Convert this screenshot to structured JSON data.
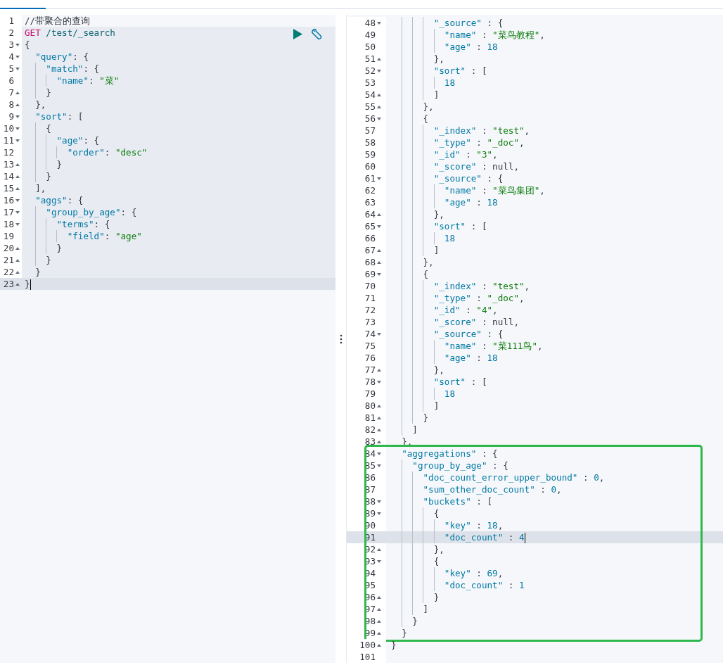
{
  "request_panel": {
    "groups": [
      {
        "kind": "plain",
        "lines": [
          {
            "number": "1",
            "active": false,
            "kind": "plain",
            "tokens": [
              {
                "kind": "comment",
                "text": "//带聚合的查询"
              }
            ]
          }
        ]
      },
      {
        "kind": "request",
        "lines": [
          {
            "number": "2",
            "active": false,
            "kind": "plain",
            "tokens": [
              {
                "kind": "method",
                "text": "GET"
              },
              {
                "kind": "url",
                "text": " /test/_search"
              }
            ]
          },
          {
            "number": "3",
            "active": false,
            "kind": "opener",
            "tokens": [
              {
                "kind": "punct",
                "text": "{"
              }
            ]
          },
          {
            "number": "4",
            "active": false,
            "kind": "opener",
            "tokens": [
              {
                "kind": "key",
                "text": "  \"query\""
              },
              {
                "kind": "punct",
                "text": ": {"
              }
            ]
          },
          {
            "number": "5",
            "active": false,
            "kind": "opener",
            "tokens": [
              {
                "kind": "key",
                "text": "    \"match\""
              },
              {
                "kind": "punct",
                "text": ": {"
              }
            ]
          },
          {
            "number": "6",
            "active": false,
            "kind": "plain",
            "tokens": [
              {
                "kind": "key",
                "text": "      \"name\""
              },
              {
                "kind": "punct",
                "text": ": "
              },
              {
                "kind": "string",
                "text": "\"菜\""
              }
            ]
          },
          {
            "number": "7",
            "active": false,
            "kind": "closer",
            "tokens": [
              {
                "kind": "punct",
                "text": "    }"
              }
            ]
          },
          {
            "number": "8",
            "active": false,
            "kind": "closer",
            "tokens": [
              {
                "kind": "punct",
                "text": "  },"
              }
            ]
          },
          {
            "number": "9",
            "active": false,
            "kind": "opener",
            "tokens": [
              {
                "kind": "key",
                "text": "  \"sort\""
              },
              {
                "kind": "punct",
                "text": ": ["
              }
            ]
          },
          {
            "number": "10",
            "active": false,
            "kind": "opener",
            "tokens": [
              {
                "kind": "punct",
                "text": "    {"
              }
            ]
          },
          {
            "number": "11",
            "active": false,
            "kind": "opener",
            "tokens": [
              {
                "kind": "key",
                "text": "      \"age\""
              },
              {
                "kind": "punct",
                "text": ": {"
              }
            ]
          },
          {
            "number": "12",
            "active": false,
            "kind": "plain",
            "tokens": [
              {
                "kind": "key",
                "text": "        \"order\""
              },
              {
                "kind": "punct",
                "text": ": "
              },
              {
                "kind": "string",
                "text": "\"desc\""
              }
            ]
          },
          {
            "number": "13",
            "active": false,
            "kind": "closer",
            "tokens": [
              {
                "kind": "punct",
                "text": "      }"
              }
            ]
          },
          {
            "number": "14",
            "active": false,
            "kind": "closer",
            "tokens": [
              {
                "kind": "punct",
                "text": "    }"
              }
            ]
          },
          {
            "number": "15",
            "active": false,
            "kind": "closer",
            "tokens": [
              {
                "kind": "punct",
                "text": "  ],"
              }
            ]
          },
          {
            "number": "16",
            "active": false,
            "kind": "opener",
            "tokens": [
              {
                "kind": "key",
                "text": "  \"aggs\""
              },
              {
                "kind": "punct",
                "text": ": {"
              }
            ]
          },
          {
            "number": "17",
            "active": false,
            "kind": "opener",
            "tokens": [
              {
                "kind": "key",
                "text": "    \"group_by_age\""
              },
              {
                "kind": "punct",
                "text": ": {"
              }
            ]
          },
          {
            "number": "18",
            "active": false,
            "kind": "opener",
            "tokens": [
              {
                "kind": "key",
                "text": "      \"terms\""
              },
              {
                "kind": "punct",
                "text": ": {"
              }
            ]
          },
          {
            "number": "19",
            "active": false,
            "kind": "plain",
            "tokens": [
              {
                "kind": "key",
                "text": "        \"field\""
              },
              {
                "kind": "punct",
                "text": ": "
              },
              {
                "kind": "string",
                "text": "\"age\""
              }
            ]
          },
          {
            "number": "20",
            "active": false,
            "kind": "closer",
            "tokens": [
              {
                "kind": "punct",
                "text": "      }"
              }
            ]
          },
          {
            "number": "21",
            "active": false,
            "kind": "closer",
            "tokens": [
              {
                "kind": "punct",
                "text": "    }"
              }
            ]
          },
          {
            "number": "22",
            "active": false,
            "kind": "closer",
            "tokens": [
              {
                "kind": "punct",
                "text": "  }"
              }
            ]
          },
          {
            "number": "23",
            "active": true,
            "kind": "closer",
            "tokens": [
              {
                "kind": "punct",
                "text": "}"
              }
            ]
          }
        ]
      }
    ]
  },
  "response_panel": {
    "groups": [
      {
        "kind": "plain",
        "lines": [
          {
            "number": "48",
            "active": false,
            "kind": "opener",
            "tokens": [
              {
                "kind": "key",
                "text": "        \"_source\""
              },
              {
                "kind": "punct",
                "text": " : {"
              }
            ]
          },
          {
            "number": "49",
            "active": false,
            "kind": "plain",
            "tokens": [
              {
                "kind": "key",
                "text": "          \"name\""
              },
              {
                "kind": "punct",
                "text": " : "
              },
              {
                "kind": "string",
                "text": "\"菜鸟教程\""
              },
              {
                "kind": "punct",
                "text": ","
              }
            ]
          },
          {
            "number": "50",
            "active": false,
            "kind": "plain",
            "tokens": [
              {
                "kind": "key",
                "text": "          \"age\""
              },
              {
                "kind": "punct",
                "text": " : "
              },
              {
                "kind": "number",
                "text": "18"
              }
            ]
          },
          {
            "number": "51",
            "active": false,
            "kind": "closer",
            "tokens": [
              {
                "kind": "punct",
                "text": "        },"
              }
            ]
          },
          {
            "number": "52",
            "active": false,
            "kind": "opener",
            "tokens": [
              {
                "kind": "key",
                "text": "        \"sort\""
              },
              {
                "kind": "punct",
                "text": " : ["
              }
            ]
          },
          {
            "number": "53",
            "active": false,
            "kind": "plain",
            "tokens": [
              {
                "kind": "number",
                "text": "          18"
              }
            ]
          },
          {
            "number": "54",
            "active": false,
            "kind": "closer",
            "tokens": [
              {
                "kind": "punct",
                "text": "        ]"
              }
            ]
          },
          {
            "number": "55",
            "active": false,
            "kind": "closer",
            "tokens": [
              {
                "kind": "punct",
                "text": "      },"
              }
            ]
          },
          {
            "number": "56",
            "active": false,
            "kind": "opener",
            "tokens": [
              {
                "kind": "punct",
                "text": "      {"
              }
            ]
          },
          {
            "number": "57",
            "active": false,
            "kind": "plain",
            "tokens": [
              {
                "kind": "key",
                "text": "        \"_index\""
              },
              {
                "kind": "punct",
                "text": " : "
              },
              {
                "kind": "string",
                "text": "\"test\""
              },
              {
                "kind": "punct",
                "text": ","
              }
            ]
          },
          {
            "number": "58",
            "active": false,
            "kind": "plain",
            "tokens": [
              {
                "kind": "key",
                "text": "        \"_type\""
              },
              {
                "kind": "punct",
                "text": " : "
              },
              {
                "kind": "string",
                "text": "\"_doc\""
              },
              {
                "kind": "punct",
                "text": ","
              }
            ]
          },
          {
            "number": "59",
            "active": false,
            "kind": "plain",
            "tokens": [
              {
                "kind": "key",
                "text": "        \"_id\""
              },
              {
                "kind": "punct",
                "text": " : "
              },
              {
                "kind": "string",
                "text": "\"3\""
              },
              {
                "kind": "punct",
                "text": ","
              }
            ]
          },
          {
            "number": "60",
            "active": false,
            "kind": "plain",
            "tokens": [
              {
                "kind": "key",
                "text": "        \"_score\""
              },
              {
                "kind": "punct",
                "text": " : "
              },
              {
                "kind": "null",
                "text": "null"
              },
              {
                "kind": "punct",
                "text": ","
              }
            ]
          },
          {
            "number": "61",
            "active": false,
            "kind": "opener",
            "tokens": [
              {
                "kind": "key",
                "text": "        \"_source\""
              },
              {
                "kind": "punct",
                "text": " : {"
              }
            ]
          },
          {
            "number": "62",
            "active": false,
            "kind": "plain",
            "tokens": [
              {
                "kind": "key",
                "text": "          \"name\""
              },
              {
                "kind": "punct",
                "text": " : "
              },
              {
                "kind": "string",
                "text": "\"菜鸟集团\""
              },
              {
                "kind": "punct",
                "text": ","
              }
            ]
          },
          {
            "number": "63",
            "active": false,
            "kind": "plain",
            "tokens": [
              {
                "kind": "key",
                "text": "          \"age\""
              },
              {
                "kind": "punct",
                "text": " : "
              },
              {
                "kind": "number",
                "text": "18"
              }
            ]
          },
          {
            "number": "64",
            "active": false,
            "kind": "closer",
            "tokens": [
              {
                "kind": "punct",
                "text": "        },"
              }
            ]
          },
          {
            "number": "65",
            "active": false,
            "kind": "opener",
            "tokens": [
              {
                "kind": "key",
                "text": "        \"sort\""
              },
              {
                "kind": "punct",
                "text": " : ["
              }
            ]
          },
          {
            "number": "66",
            "active": false,
            "kind": "plain",
            "tokens": [
              {
                "kind": "number",
                "text": "          18"
              }
            ]
          },
          {
            "number": "67",
            "active": false,
            "kind": "closer",
            "tokens": [
              {
                "kind": "punct",
                "text": "        ]"
              }
            ]
          },
          {
            "number": "68",
            "active": false,
            "kind": "closer",
            "tokens": [
              {
                "kind": "punct",
                "text": "      },"
              }
            ]
          },
          {
            "number": "69",
            "active": false,
            "kind": "opener",
            "tokens": [
              {
                "kind": "punct",
                "text": "      {"
              }
            ]
          },
          {
            "number": "70",
            "active": false,
            "kind": "plain",
            "tokens": [
              {
                "kind": "key",
                "text": "        \"_index\""
              },
              {
                "kind": "punct",
                "text": " : "
              },
              {
                "kind": "string",
                "text": "\"test\""
              },
              {
                "kind": "punct",
                "text": ","
              }
            ]
          },
          {
            "number": "71",
            "active": false,
            "kind": "plain",
            "tokens": [
              {
                "kind": "key",
                "text": "        \"_type\""
              },
              {
                "kind": "punct",
                "text": " : "
              },
              {
                "kind": "string",
                "text": "\"_doc\""
              },
              {
                "kind": "punct",
                "text": ","
              }
            ]
          },
          {
            "number": "72",
            "active": false,
            "kind": "plain",
            "tokens": [
              {
                "kind": "key",
                "text": "        \"_id\""
              },
              {
                "kind": "punct",
                "text": " : "
              },
              {
                "kind": "string",
                "text": "\"4\""
              },
              {
                "kind": "punct",
                "text": ","
              }
            ]
          },
          {
            "number": "73",
            "active": false,
            "kind": "plain",
            "tokens": [
              {
                "kind": "key",
                "text": "        \"_score\""
              },
              {
                "kind": "punct",
                "text": " : "
              },
              {
                "kind": "null",
                "text": "null"
              },
              {
                "kind": "punct",
                "text": ","
              }
            ]
          },
          {
            "number": "74",
            "active": false,
            "kind": "opener",
            "tokens": [
              {
                "kind": "key",
                "text": "        \"_source\""
              },
              {
                "kind": "punct",
                "text": " : {"
              }
            ]
          },
          {
            "number": "75",
            "active": false,
            "kind": "plain",
            "tokens": [
              {
                "kind": "key",
                "text": "          \"name\""
              },
              {
                "kind": "punct",
                "text": " : "
              },
              {
                "kind": "string",
                "text": "\"菜111鸟\""
              },
              {
                "kind": "punct",
                "text": ","
              }
            ]
          },
          {
            "number": "76",
            "active": false,
            "kind": "plain",
            "tokens": [
              {
                "kind": "key",
                "text": "          \"age\""
              },
              {
                "kind": "punct",
                "text": " : "
              },
              {
                "kind": "number",
                "text": "18"
              }
            ]
          },
          {
            "number": "77",
            "active": false,
            "kind": "closer",
            "tokens": [
              {
                "kind": "punct",
                "text": "        },"
              }
            ]
          },
          {
            "number": "78",
            "active": false,
            "kind": "opener",
            "tokens": [
              {
                "kind": "key",
                "text": "        \"sort\""
              },
              {
                "kind": "punct",
                "text": " : ["
              }
            ]
          },
          {
            "number": "79",
            "active": false,
            "kind": "plain",
            "tokens": [
              {
                "kind": "number",
                "text": "          18"
              }
            ]
          },
          {
            "number": "80",
            "active": false,
            "kind": "closer",
            "tokens": [
              {
                "kind": "punct",
                "text": "        ]"
              }
            ]
          },
          {
            "number": "81",
            "active": false,
            "kind": "closer",
            "tokens": [
              {
                "kind": "punct",
                "text": "      }"
              }
            ]
          },
          {
            "number": "82",
            "active": false,
            "kind": "closer",
            "tokens": [
              {
                "kind": "punct",
                "text": "    ]"
              }
            ]
          },
          {
            "number": "83",
            "active": false,
            "kind": "closer",
            "tokens": [
              {
                "kind": "punct",
                "text": "  },"
              }
            ]
          }
        ]
      },
      {
        "kind": "annotated",
        "lines": [
          {
            "number": "84",
            "active": false,
            "kind": "opener",
            "tokens": [
              {
                "kind": "key",
                "text": "  \"aggregations\""
              },
              {
                "kind": "punct",
                "text": " : {"
              }
            ]
          },
          {
            "number": "85",
            "active": false,
            "kind": "opener",
            "tokens": [
              {
                "kind": "key",
                "text": "    \"group_by_age\""
              },
              {
                "kind": "punct",
                "text": " : {"
              }
            ]
          },
          {
            "number": "86",
            "active": false,
            "kind": "plain",
            "tokens": [
              {
                "kind": "key",
                "text": "      \"doc_count_error_upper_bound\""
              },
              {
                "kind": "punct",
                "text": " : "
              },
              {
                "kind": "number",
                "text": "0"
              },
              {
                "kind": "punct",
                "text": ","
              }
            ]
          },
          {
            "number": "87",
            "active": false,
            "kind": "plain",
            "tokens": [
              {
                "kind": "key",
                "text": "      \"sum_other_doc_count\""
              },
              {
                "kind": "punct",
                "text": " : "
              },
              {
                "kind": "number",
                "text": "0"
              },
              {
                "kind": "punct",
                "text": ","
              }
            ]
          },
          {
            "number": "88",
            "active": false,
            "kind": "opener",
            "tokens": [
              {
                "kind": "key",
                "text": "      \"buckets\""
              },
              {
                "kind": "punct",
                "text": " : ["
              }
            ]
          },
          {
            "number": "89",
            "active": false,
            "kind": "opener",
            "tokens": [
              {
                "kind": "punct",
                "text": "        {"
              }
            ]
          },
          {
            "number": "90",
            "active": false,
            "kind": "plain",
            "tokens": [
              {
                "kind": "key",
                "text": "          \"key\""
              },
              {
                "kind": "punct",
                "text": " : "
              },
              {
                "kind": "number",
                "text": "18"
              },
              {
                "kind": "punct",
                "text": ","
              }
            ]
          },
          {
            "number": "91",
            "active": true,
            "kind": "plain",
            "tokens": [
              {
                "kind": "key",
                "text": "          \"doc_count\""
              },
              {
                "kind": "punct",
                "text": " : "
              },
              {
                "kind": "number",
                "text": "4"
              }
            ]
          },
          {
            "number": "92",
            "active": false,
            "kind": "closer",
            "tokens": [
              {
                "kind": "punct",
                "text": "        },"
              }
            ]
          },
          {
            "number": "93",
            "active": false,
            "kind": "opener",
            "tokens": [
              {
                "kind": "punct",
                "text": "        {"
              }
            ]
          },
          {
            "number": "94",
            "active": false,
            "kind": "plain",
            "tokens": [
              {
                "kind": "key",
                "text": "          \"key\""
              },
              {
                "kind": "punct",
                "text": " : "
              },
              {
                "kind": "number",
                "text": "69"
              },
              {
                "kind": "punct",
                "text": ","
              }
            ]
          },
          {
            "number": "95",
            "active": false,
            "kind": "plain",
            "tokens": [
              {
                "kind": "key",
                "text": "          \"doc_count\""
              },
              {
                "kind": "punct",
                "text": " : "
              },
              {
                "kind": "number",
                "text": "1"
              }
            ]
          },
          {
            "number": "96",
            "active": false,
            "kind": "closer",
            "tokens": [
              {
                "kind": "punct",
                "text": "        }"
              }
            ]
          },
          {
            "number": "97",
            "active": false,
            "kind": "closer",
            "tokens": [
              {
                "kind": "punct",
                "text": "      ]"
              }
            ]
          },
          {
            "number": "98",
            "active": false,
            "kind": "closer",
            "tokens": [
              {
                "kind": "punct",
                "text": "    }"
              }
            ]
          },
          {
            "number": "99",
            "active": false,
            "kind": "closer",
            "tokens": [
              {
                "kind": "punct",
                "text": "  }"
              }
            ]
          }
        ]
      },
      {
        "kind": "plain",
        "lines": [
          {
            "number": "100",
            "active": false,
            "kind": "closer",
            "tokens": [
              {
                "kind": "punct",
                "text": "}"
              }
            ]
          },
          {
            "number": "101",
            "active": false,
            "kind": "plain"
          }
        ]
      }
    ]
  }
}
